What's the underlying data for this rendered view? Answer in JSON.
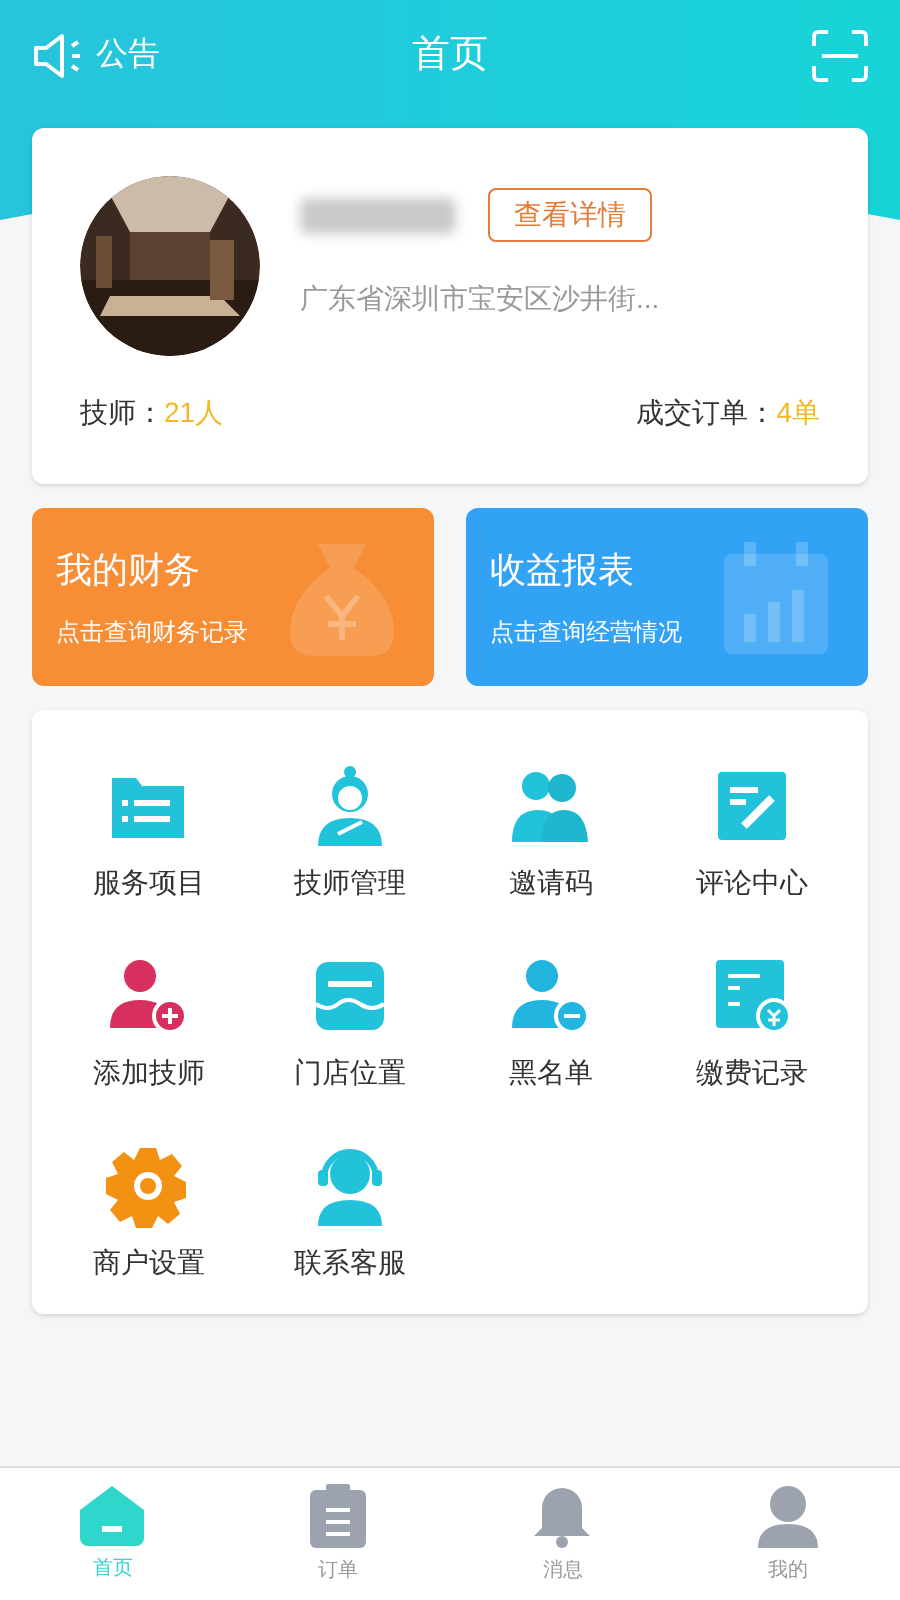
{
  "header": {
    "notice": "公告",
    "title": "首页"
  },
  "store": {
    "details_button": "查看详情",
    "address": "广东省深圳市宝安区沙井街...",
    "technicians_label": "技师：",
    "technicians": "21人",
    "orders_label": "成交订单：",
    "orders": "4单"
  },
  "banners": [
    {
      "kind": "finance",
      "title": "我的财务",
      "subtitle": "点击查询财务记录"
    },
    {
      "kind": "report",
      "title": "收益报表",
      "subtitle": "点击查询经营情况"
    }
  ],
  "menu": [
    {
      "kind": "folder",
      "label": "服务项目"
    },
    {
      "kind": "staff",
      "label": "技师管理"
    },
    {
      "kind": "people",
      "label": "邀请码"
    },
    {
      "kind": "note",
      "label": "评论中心"
    },
    {
      "kind": "add-user",
      "label": "添加技师"
    },
    {
      "kind": "store",
      "label": "门店位置"
    },
    {
      "kind": "remove-user",
      "label": "黑名单"
    },
    {
      "kind": "bill",
      "label": "缴费记录"
    },
    {
      "kind": "gear",
      "label": "商户设置"
    },
    {
      "kind": "headset",
      "label": "联系客服"
    }
  ],
  "tabs": [
    {
      "kind": "home",
      "label": "首页",
      "selected": true
    },
    {
      "kind": "orders",
      "label": "订单",
      "selected": false
    },
    {
      "kind": "bell",
      "label": "消息",
      "selected": false
    },
    {
      "kind": "user",
      "label": "我的",
      "selected": false
    }
  ]
}
